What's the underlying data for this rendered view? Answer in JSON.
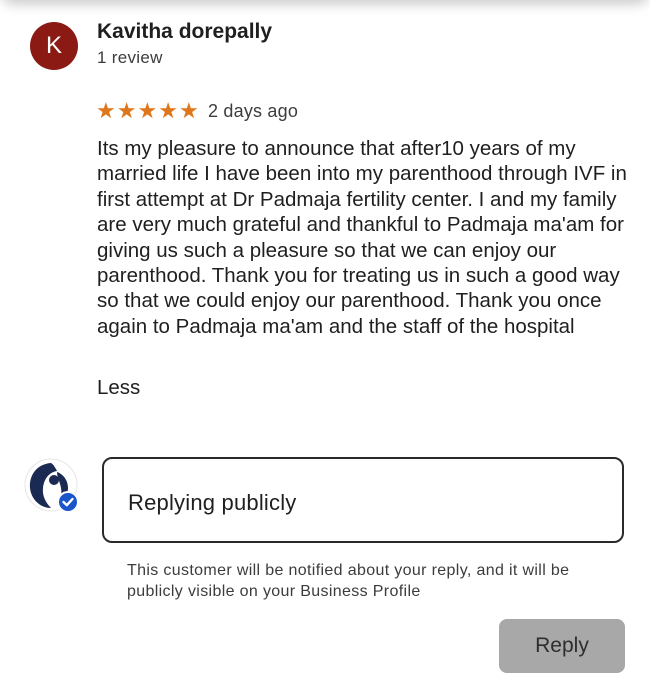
{
  "review": {
    "avatar_initial": "K",
    "reviewer_name": "Kavitha dorepally",
    "review_count": "1 review",
    "rating": 5,
    "stars": [
      "★",
      "★",
      "★",
      "★",
      "★"
    ],
    "date": "2 days ago",
    "text": "Its my pleasure to announce that after10 years of my married life I have been into my parenthood through IVF in first attempt at Dr Padmaja fertility center. I and my family are very much grateful and thankful to Padmaja ma'am for giving us such a pleasure so that we can enjoy our parenthood. Thank you for treating us in such a good way so that we could enjoy our parenthood. Thank you once again to Padmaja ma'am and the staff of the hospital",
    "less_link": "Less"
  },
  "reply": {
    "placeholder": "Replying publicly",
    "notice": "This customer will be notified about your reply, and it will be publicly visible on your Business Profile",
    "button_label": "Reply"
  },
  "colors": {
    "avatar_bg": "#8b1a14",
    "star": "#e0761b",
    "verified_badge": "#1a56c9",
    "button_disabled": "#a8a8a8"
  }
}
